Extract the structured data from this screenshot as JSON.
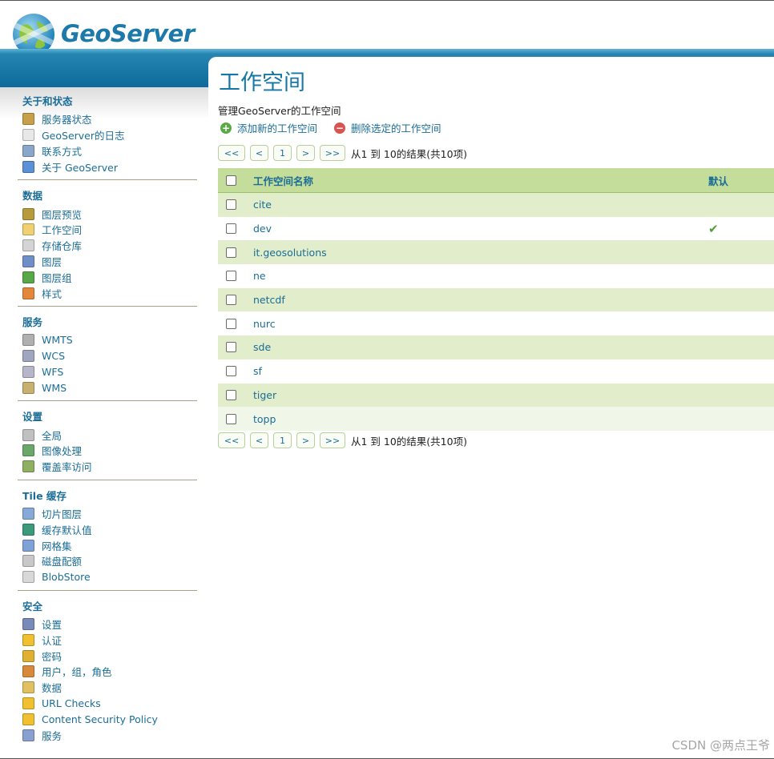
{
  "header": {
    "brand": "GeoServer"
  },
  "sidebar": {
    "sections": [
      {
        "title": "关于和状态",
        "items": [
          {
            "label": "服务器状态",
            "icon": "server-status-icon"
          },
          {
            "label": "GeoServer的日志",
            "icon": "log-icon"
          },
          {
            "label": "联系方式",
            "icon": "contact-icon"
          },
          {
            "label": "关于 GeoServer",
            "icon": "about-icon"
          }
        ]
      },
      {
        "title": "数据",
        "items": [
          {
            "label": "图层预览",
            "icon": "layer-preview-icon"
          },
          {
            "label": "工作空间",
            "icon": "folder-icon"
          },
          {
            "label": "存储仓库",
            "icon": "store-icon"
          },
          {
            "label": "图层",
            "icon": "layer-icon"
          },
          {
            "label": "图层组",
            "icon": "layer-group-icon"
          },
          {
            "label": "样式",
            "icon": "style-icon"
          }
        ]
      },
      {
        "title": "服务",
        "items": [
          {
            "label": "WMTS",
            "icon": "wmts-icon"
          },
          {
            "label": "WCS",
            "icon": "wcs-icon"
          },
          {
            "label": "WFS",
            "icon": "wfs-icon"
          },
          {
            "label": "WMS",
            "icon": "wms-icon"
          }
        ]
      },
      {
        "title": "设置",
        "items": [
          {
            "label": "全局",
            "icon": "global-icon"
          },
          {
            "label": "图像处理",
            "icon": "image-processing-icon"
          },
          {
            "label": "覆盖率访问",
            "icon": "coverage-access-icon"
          }
        ]
      },
      {
        "title": "Tile 缓存",
        "items": [
          {
            "label": "切片图层",
            "icon": "tile-layers-icon"
          },
          {
            "label": "缓存默认值",
            "icon": "cache-defaults-icon"
          },
          {
            "label": "网格集",
            "icon": "gridsets-icon"
          },
          {
            "label": "磁盘配额",
            "icon": "disk-quota-icon"
          },
          {
            "label": "BlobStore",
            "icon": "blobstore-icon"
          }
        ]
      },
      {
        "title": "安全",
        "items": [
          {
            "label": "设置",
            "icon": "wrench-icon"
          },
          {
            "label": "认证",
            "icon": "shield-icon"
          },
          {
            "label": "密码",
            "icon": "lock-icon"
          },
          {
            "label": "用户，组，角色",
            "icon": "users-icon"
          },
          {
            "label": "数据",
            "icon": "data-security-icon"
          },
          {
            "label": "URL Checks",
            "icon": "shield-icon"
          },
          {
            "label": "Content Security Policy",
            "icon": "shield-icon"
          },
          {
            "label": "服务",
            "icon": "services-security-icon"
          }
        ]
      }
    ]
  },
  "main": {
    "title": "工作空间",
    "description": "管理GeoServer的工作空间",
    "add_label": "添加新的工作空间",
    "remove_label": "删除选定的工作空间",
    "pager": {
      "first": "<<",
      "prev": "<",
      "page": "1",
      "next": ">",
      "last": ">>",
      "info": "从1 到 10的结果(共10项)"
    },
    "table": {
      "columns": {
        "name": "工作空间名称",
        "default": "默认"
      },
      "rows": [
        {
          "name": "cite",
          "default": false
        },
        {
          "name": "dev",
          "default": true
        },
        {
          "name": "it.geosolutions",
          "default": false
        },
        {
          "name": "ne",
          "default": false
        },
        {
          "name": "netcdf",
          "default": false
        },
        {
          "name": "nurc",
          "default": false
        },
        {
          "name": "sde",
          "default": false
        },
        {
          "name": "sf",
          "default": false
        },
        {
          "name": "tiger",
          "default": false
        },
        {
          "name": "topp",
          "default": false
        }
      ]
    }
  },
  "watermark": "CSDN @两点王爷",
  "colors": {
    "accent": "#1b6d97",
    "header_band": "#0d6a9a",
    "table_header": "#c5dd9a",
    "row_alt": "#e1edcb"
  }
}
